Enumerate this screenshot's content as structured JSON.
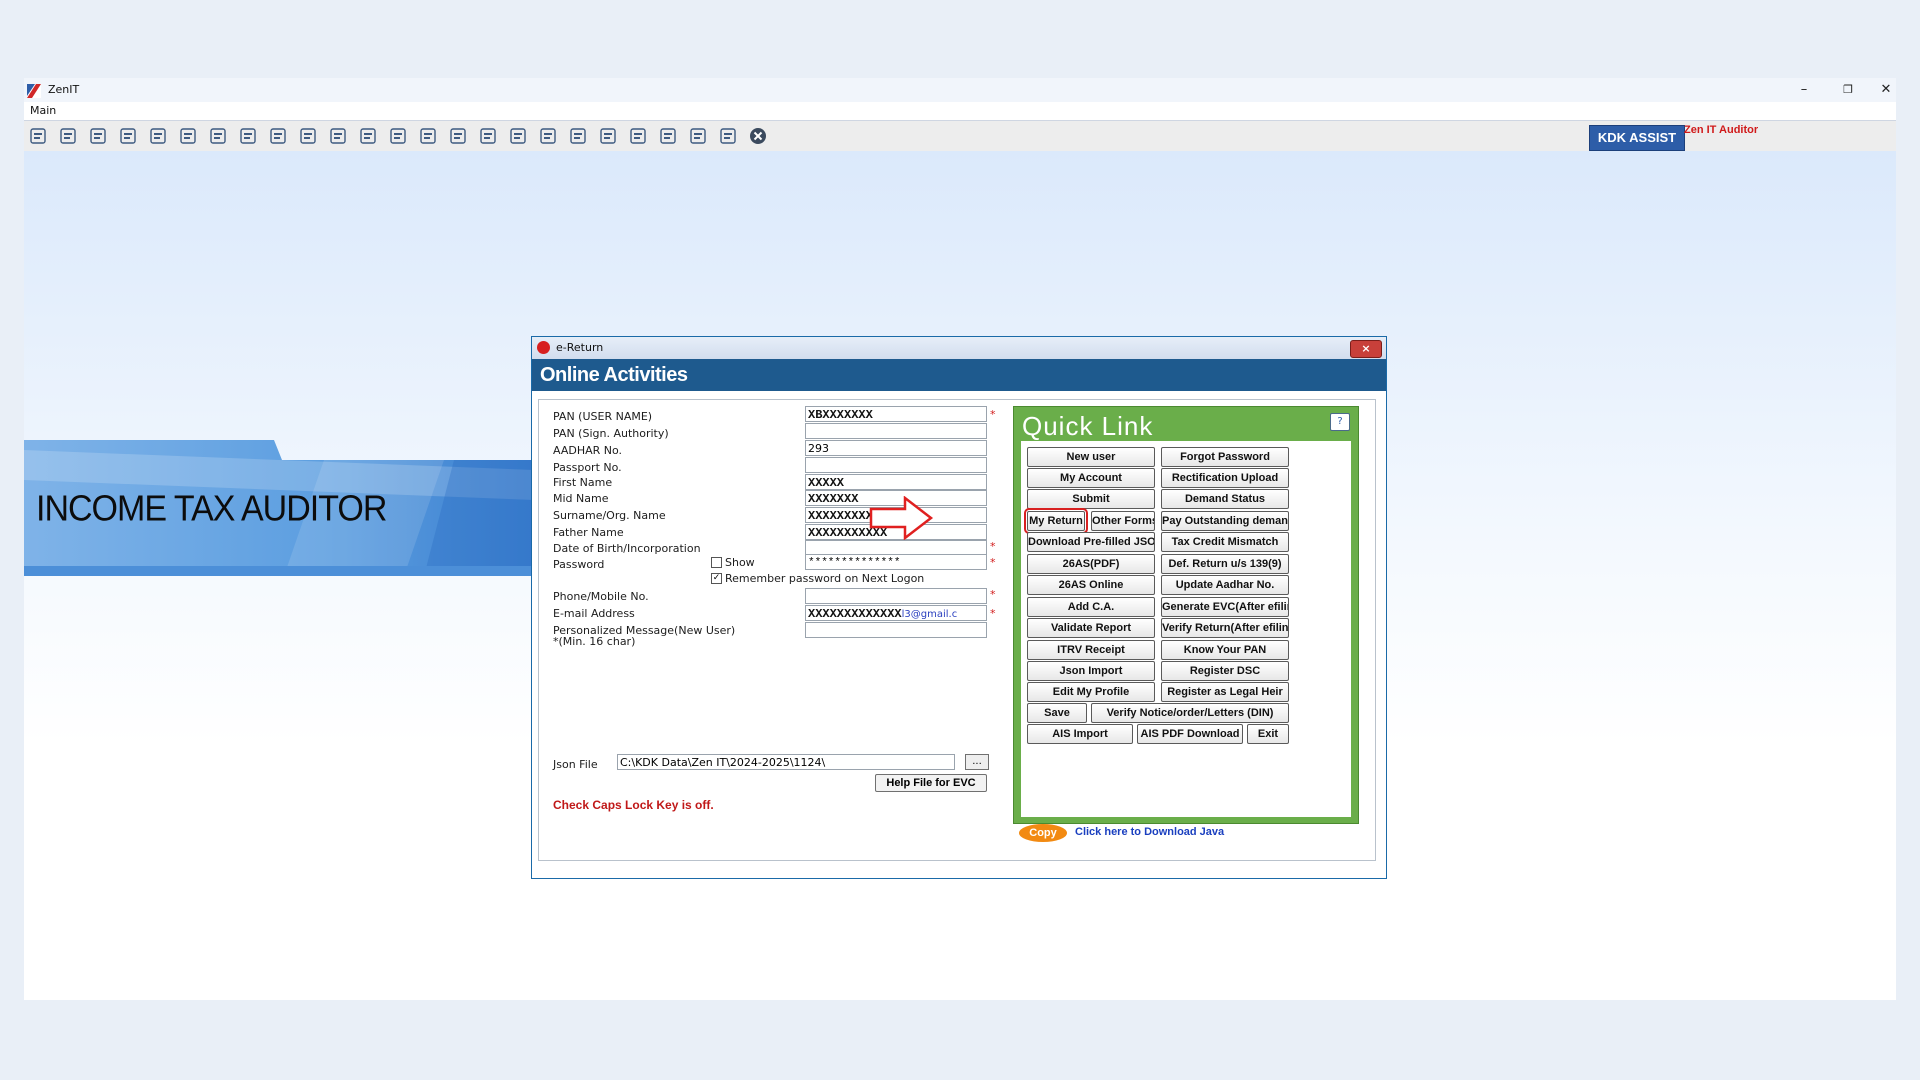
{
  "window": {
    "title": "ZenIT",
    "minimize": "–",
    "restore": "❐",
    "close": "✕"
  },
  "menu": {
    "main": "Main"
  },
  "toolbar": {
    "kdk_assist": "KDK ASSIST",
    "zen_auditor": "Zen IT Auditor",
    "icons": [
      "rupee-doc-icon",
      "home-icon",
      "building-icon",
      "bar-chart-icon",
      "gift-icon",
      "people-icon",
      "hammer-icon",
      "filter-icon",
      "tax-icon",
      "coins-icon",
      "calculator-icon",
      "pie-icon",
      "pay-icon",
      "book-icon",
      "info-icon",
      "report-icon",
      "doc-search-icon",
      "calendar-icon",
      "map-icon",
      "copy-icon",
      "bs-icon",
      "stack-icon",
      "3cd-icon",
      "form-icon",
      "close-circle-icon"
    ]
  },
  "banner": {
    "text": "INCOME TAX AUDITOR"
  },
  "dialog": {
    "title": "e-Return",
    "close_label": "×",
    "heading": "Online Activities",
    "fields": {
      "pan_label": "PAN (USER NAME)",
      "pan_value": "XBXXXXXXX",
      "pan_sign_label": "PAN (Sign. Authority)",
      "pan_sign_value": "",
      "aadhar_label": "AADHAR No.",
      "aadhar_value": "293",
      "passport_label": "Passport No.",
      "passport_value": "",
      "first_name_label": "First Name",
      "first_name_value": "XXXXX",
      "mid_name_label": "Mid Name",
      "mid_name_value": "XXXXXXX",
      "surname_label": "Surname/Org. Name",
      "surname_value": "XXXXXXXXXXXXX",
      "father_label": "Father Name",
      "father_value": "XXXXXXXXXXX",
      "dob_label": "Date of Birth/Incorporation",
      "dob_value": "",
      "password_label": "Password",
      "password_value": "**************",
      "show_label": "Show",
      "remember_label": "Remember password on Next Logon",
      "phone_label": "Phone/Mobile No.",
      "phone_value": "",
      "email_label": "E-mail Address",
      "email_value": "XXXXXXXXXXXXX",
      "email_suffix": "l3@gmail.c",
      "msg_label_1": "Personalized Message(New User)",
      "msg_label_2": "*(Min. 16 char)",
      "msg_value": "",
      "required_mark": "*"
    },
    "json_file": {
      "label": "Json File",
      "value": "C:\\KDK Data\\Zen IT\\2024-2025\\1124\\",
      "browse": "..."
    },
    "help_evc": "Help File for EVC",
    "caps_warning": "Check Caps Lock Key is off.",
    "quick_link": {
      "title": "Quick Link",
      "help": "?",
      "buttons": {
        "new_user": "New user",
        "forgot_password": "Forgot Password",
        "my_account": "My Account",
        "rectification_upload": "Rectification Upload",
        "submit": "Submit",
        "demand_status": "Demand Status",
        "my_return": "My Return",
        "other_forms": "Other Forms",
        "pay_outstanding": "Pay Outstanding demand",
        "download_prefilled": "Download Pre-filled JSON",
        "tax_credit_mismatch": "Tax Credit Mismatch",
        "as26_pdf": "26AS(PDF)",
        "def_return": "Def. Return u/s 139(9)",
        "as26_online": "26AS Online",
        "update_aadhar": "Update Aadhar No.",
        "add_ca": "Add C.A.",
        "generate_evc": "Generate EVC(After efiling)",
        "validate_report": "Validate Report",
        "verify_return": "Verify Return(After efiling)",
        "itrv_receipt": "ITRV Receipt",
        "know_pan": "Know Your PAN",
        "json_import": "Json Import",
        "register_dsc": "Register DSC",
        "edit_profile": "Edit My Profile",
        "register_legal_heir": "Register as Legal Heir",
        "save": "Save",
        "verify_notice": "Verify Notice/order/Letters (DIN)",
        "ais_import": "AIS Import",
        "ais_pdf": "AIS PDF Download",
        "exit": "Exit"
      }
    },
    "copy": "Copy",
    "java_link": "Click here to Download Java"
  },
  "colors": {
    "dialog_header": "#1e5a8e",
    "quick_link_bg": "#6aae4a",
    "highlight": "#d82020",
    "warning_text": "#c01818"
  }
}
